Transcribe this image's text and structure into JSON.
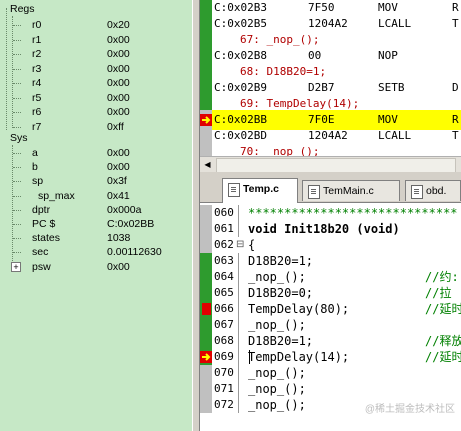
{
  "registers": {
    "regs_group": "Regs",
    "regs": [
      {
        "name": "r0",
        "value": "0x20"
      },
      {
        "name": "r1",
        "value": "0x00"
      },
      {
        "name": "r2",
        "value": "0x00"
      },
      {
        "name": "r3",
        "value": "0x00"
      },
      {
        "name": "r4",
        "value": "0x00"
      },
      {
        "name": "r5",
        "value": "0x00"
      },
      {
        "name": "r6",
        "value": "0x00"
      },
      {
        "name": "r7",
        "value": "0xff"
      }
    ],
    "sys_group": "Sys",
    "sys": [
      {
        "name": "a",
        "value": "0x00"
      },
      {
        "name": "b",
        "value": "0x00"
      },
      {
        "name": "sp",
        "value": "0x3f"
      },
      {
        "name": "sp_max",
        "value": "0x41"
      },
      {
        "name": "dptr",
        "value": "0x000a"
      },
      {
        "name": "PC  $",
        "value": "C:0x02BB"
      },
      {
        "name": "states",
        "value": "1038"
      },
      {
        "name": "sec",
        "value": "0.00112630"
      },
      {
        "name": "psw",
        "value": "0x00"
      }
    ],
    "psw_expander": "+"
  },
  "disassembly": [
    {
      "addr": "C:0x02B3",
      "op": "7F50",
      "mnem": "MOV",
      "arg": "R"
    },
    {
      "addr": "C:0x02B5",
      "op": "1204A2",
      "mnem": "LCALL",
      "arg": "T"
    },
    {
      "src": "67:             _nop_();"
    },
    {
      "addr": "C:0x02B8",
      "op": "00",
      "mnem": "NOP",
      "arg": ""
    },
    {
      "src": "68:          D18B20=1;"
    },
    {
      "addr": "C:0x02B9",
      "op": "D2B7",
      "mnem": "SETB",
      "arg": "D"
    },
    {
      "src": "69:          TempDelay(14);"
    },
    {
      "addr": "C:0x02BB",
      "op": "7F0E",
      "mnem": "MOV",
      "arg": "R"
    },
    {
      "addr": "C:0x02BD",
      "op": "1204A2",
      "mnem": "LCALL",
      "arg": "T"
    },
    {
      "src": "70:             _nop_();"
    }
  ],
  "scroll_arrow": "◀",
  "tabs": [
    {
      "label": "Temp.c"
    },
    {
      "label": "TemMain.c"
    },
    {
      "label": "obd."
    }
  ],
  "code_lines": [
    {
      "num": "060",
      "text": "*****************************"
    },
    {
      "num": "061",
      "text": "void Init18b20 (void)"
    },
    {
      "num": "062",
      "text": "{"
    },
    {
      "num": "063",
      "text": "    D18B20=1;"
    },
    {
      "num": "064",
      "text": "    _nop_();",
      "comment": "//约:"
    },
    {
      "num": "065",
      "text": "    D18B20=0;",
      "comment": "//拉"
    },
    {
      "num": "066",
      "text": "    TempDelay(80);",
      "comment": "//延时"
    },
    {
      "num": "067",
      "text": "    _nop_();"
    },
    {
      "num": "068",
      "text": "    D18B20=1;",
      "comment": "//释放"
    },
    {
      "num": "069",
      "text": "    TempDelay(14);",
      "comment": "//延时"
    },
    {
      "num": "070",
      "text": "    _nop_();"
    },
    {
      "num": "071",
      "text": "    _nop_();"
    },
    {
      "num": "072",
      "text": "    _nop_();"
    }
  ],
  "fold_marker": "⊟",
  "watermark": "@稀土掘金技术社区",
  "colors": {
    "reg_panel_bg": "#c6e8c6",
    "highlight": "#ffff00",
    "breakpoint": "#e00000",
    "source_line": "#b00000",
    "comment": "#008000"
  }
}
